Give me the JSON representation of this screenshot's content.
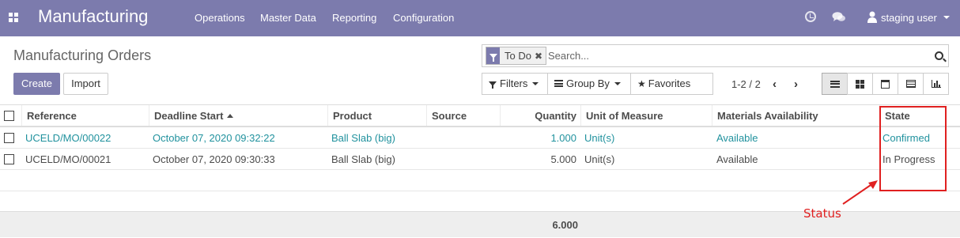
{
  "navbar": {
    "app_name": "Manufacturing",
    "menu": [
      "Operations",
      "Master Data",
      "Reporting",
      "Configuration"
    ],
    "user": "staging user",
    "icons": [
      "apps-icon",
      "clock-icon",
      "chat-icon",
      "user-icon"
    ],
    "bg_color": "#7c7bad"
  },
  "control_panel": {
    "title": "Manufacturing Orders",
    "create_label": "Create",
    "import_label": "Import",
    "search": {
      "facet_label": "To Do",
      "facet_remove": "✖",
      "placeholder": "Search..."
    },
    "filters_label": "Filters",
    "groupby_label": "Group By",
    "favorites_label": "Favorites",
    "pager": "1-2 / 2",
    "pager_prev": "‹",
    "pager_next": "›",
    "views": [
      "list",
      "kanban",
      "calendar",
      "pivot",
      "graph"
    ],
    "active_view": "list"
  },
  "table": {
    "columns": [
      "Reference",
      "Deadline Start",
      "Product",
      "Source",
      "Quantity",
      "Unit of Measure",
      "Materials Availability",
      "State"
    ],
    "sorted_column": "Deadline Start",
    "rows": [
      {
        "reference": "UCELD/MO/00022",
        "deadline": "October 07, 2020 09:32:22",
        "product": "Ball Slab (big)",
        "source": "",
        "quantity": "1.000",
        "uom": "Unit(s)",
        "availability": "Available",
        "state": "Confirmed",
        "highlight": true
      },
      {
        "reference": "UCELD/MO/00021",
        "deadline": "October 07, 2020 09:30:33",
        "product": "Ball Slab (big)",
        "source": "",
        "quantity": "5.000",
        "uom": "Unit(s)",
        "availability": "Available",
        "state": "In Progress",
        "highlight": false
      }
    ],
    "total_quantity": "6.000",
    "link_color": "#21929e"
  },
  "annotation": {
    "label": "Status",
    "color": "#e02020"
  }
}
